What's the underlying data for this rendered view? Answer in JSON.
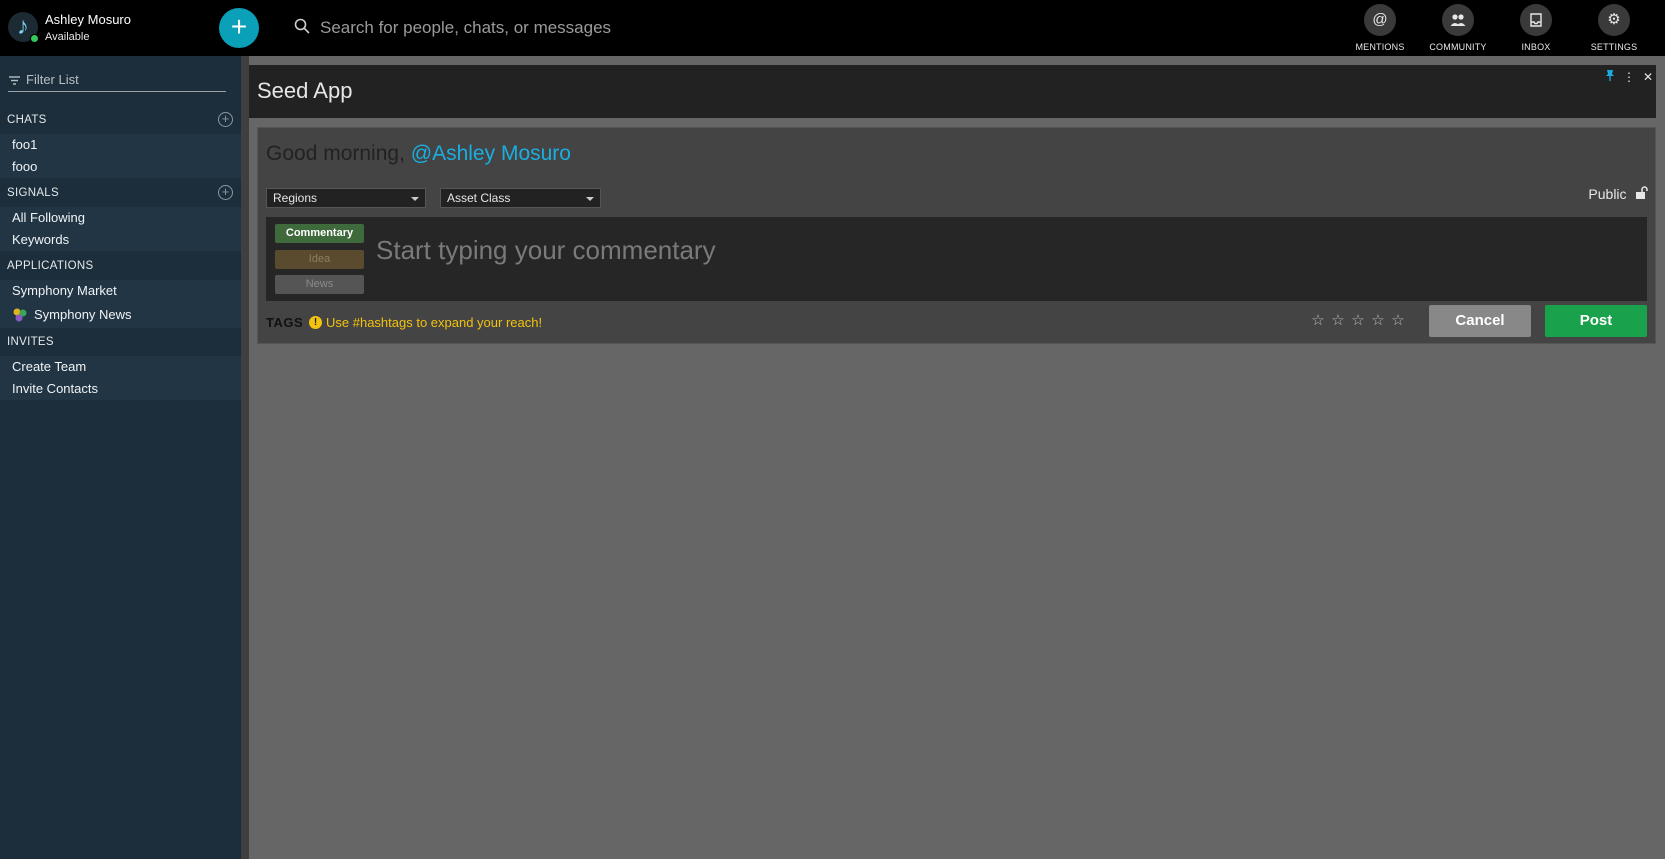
{
  "topbar": {
    "user": {
      "name": "Ashley Mosuro",
      "status": "Available",
      "avatar_icon": "music-note-icon"
    },
    "search": {
      "placeholder": "Search for people, chats, or messages"
    },
    "nav": [
      {
        "label": "MENTIONS",
        "icon": "at-sign-icon"
      },
      {
        "label": "COMMUNITY",
        "icon": "people-icon"
      },
      {
        "label": "INBOX",
        "icon": "inbox-icon"
      },
      {
        "label": "SETTINGS",
        "icon": "gear-icon"
      }
    ]
  },
  "sidebar": {
    "filter_label": "Filter List",
    "chats": {
      "title": "CHATS",
      "items": [
        "foo1",
        "fooo"
      ]
    },
    "signals": {
      "title": "SIGNALS",
      "items": [
        "All Following",
        "Keywords"
      ]
    },
    "applications": {
      "title": "APPLICATIONS",
      "items": [
        "Symphony Market",
        "Symphony News"
      ]
    },
    "invites": {
      "title": "INVITES",
      "items": [
        "Create Team",
        "Invite Contacts"
      ]
    }
  },
  "panel": {
    "title": "Seed App",
    "greeting_prefix": "Good morning,",
    "greeting_mention": "@Ashley Mosuro",
    "regions_label": "Regions",
    "asset_class_label": "Asset Class",
    "visibility_label": "Public",
    "post_types": [
      "Commentary",
      "Idea",
      "News"
    ],
    "editor_placeholder": "Start typing your commentary",
    "tags_label": "TAGS",
    "hint_text": "Use #hashtags to expand your reach!",
    "rating": 0,
    "cancel_label": "Cancel",
    "post_label": "Post"
  },
  "colors": {
    "accent": "#0aa0b8",
    "mention": "#1aaee0",
    "post": "#1aa14b",
    "hint": "#f2c20f",
    "sidebar": "#1c2e3b"
  }
}
